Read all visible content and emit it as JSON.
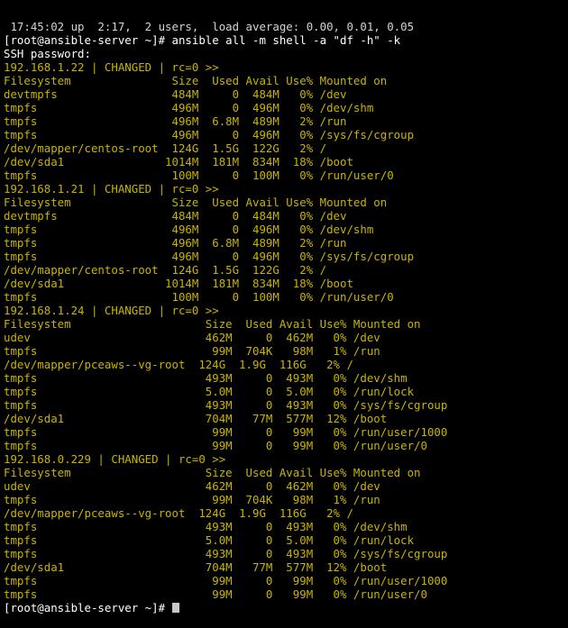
{
  "terminal": {
    "colors": {
      "background": "#000000",
      "default_text": "#d4d4d4",
      "changed_header": "#c8b400",
      "filesystem_rows": "#2ecc40"
    },
    "lines": [
      {
        "text": " 17:45:02 up  2:17,  2 users,  load average: 0.00, 0.01, 0.05",
        "color": "gray"
      },
      {
        "text": "[root@ansible-server ~]# ansible all -m shell -a \"df -h\" -k",
        "color": "white"
      },
      {
        "text": "SSH password:",
        "color": "white"
      },
      {
        "text": "192.168.1.22 | CHANGED | rc=0 >>",
        "color": "yellow"
      },
      {
        "text": "Filesystem               Size  Used Avail Use% Mounted on",
        "color": "yellow"
      },
      {
        "text": "devtmpfs                 484M     0  484M   0% /dev",
        "color": "yellow"
      },
      {
        "text": "tmpfs                    496M     0  496M   0% /dev/shm",
        "color": "yellow"
      },
      {
        "text": "tmpfs                    496M  6.8M  489M   2% /run",
        "color": "yellow"
      },
      {
        "text": "tmpfs                    496M     0  496M   0% /sys/fs/cgroup",
        "color": "yellow"
      },
      {
        "text": "/dev/mapper/centos-root  124G  1.5G  122G   2% /",
        "color": "yellow"
      },
      {
        "text": "/dev/sda1               1014M  181M  834M  18% /boot",
        "color": "yellow"
      },
      {
        "text": "tmpfs                    100M     0  100M   0% /run/user/0",
        "color": "yellow"
      },
      {
        "text": "192.168.1.21 | CHANGED | rc=0 >>",
        "color": "yellow"
      },
      {
        "text": "Filesystem               Size  Used Avail Use% Mounted on",
        "color": "yellow"
      },
      {
        "text": "devtmpfs                 484M     0  484M   0% /dev",
        "color": "yellow"
      },
      {
        "text": "tmpfs                    496M     0  496M   0% /dev/shm",
        "color": "yellow"
      },
      {
        "text": "tmpfs                    496M  6.8M  489M   2% /run",
        "color": "yellow"
      },
      {
        "text": "tmpfs                    496M     0  496M   0% /sys/fs/cgroup",
        "color": "yellow"
      },
      {
        "text": "/dev/mapper/centos-root  124G  1.5G  122G   2% /",
        "color": "yellow"
      },
      {
        "text": "/dev/sda1               1014M  181M  834M  18% /boot",
        "color": "yellow"
      },
      {
        "text": "tmpfs                    100M     0  100M   0% /run/user/0",
        "color": "yellow"
      },
      {
        "text": "192.168.1.24 | CHANGED | rc=0 >>",
        "color": "yellow"
      },
      {
        "text": "Filesystem                    Size  Used Avail Use% Mounted on",
        "color": "yellow"
      },
      {
        "text": "udev                          462M     0  462M   0% /dev",
        "color": "yellow"
      },
      {
        "text": "tmpfs                          99M  704K   98M   1% /run",
        "color": "yellow"
      },
      {
        "text": "/dev/mapper/pceaws--vg-root  124G  1.9G  116G   2% /",
        "color": "yellow"
      },
      {
        "text": "tmpfs                         493M     0  493M   0% /dev/shm",
        "color": "yellow"
      },
      {
        "text": "tmpfs                         5.0M     0  5.0M   0% /run/lock",
        "color": "yellow"
      },
      {
        "text": "tmpfs                         493M     0  493M   0% /sys/fs/cgroup",
        "color": "yellow"
      },
      {
        "text": "/dev/sda1                     704M   77M  577M  12% /boot",
        "color": "yellow"
      },
      {
        "text": "tmpfs                          99M     0   99M   0% /run/user/1000",
        "color": "yellow"
      },
      {
        "text": "tmpfs                          99M     0   99M   0% /run/user/0",
        "color": "yellow"
      },
      {
        "text": "192.168.0.229 | CHANGED | rc=0 >>",
        "color": "yellow"
      },
      {
        "text": "Filesystem                    Size  Used Avail Use% Mounted on",
        "color": "yellow"
      },
      {
        "text": "udev                          462M     0  462M   0% /dev",
        "color": "yellow"
      },
      {
        "text": "tmpfs                          99M  704K   98M   1% /run",
        "color": "yellow"
      },
      {
        "text": "/dev/mapper/pceaws--vg-root  124G  1.9G  116G   2% /",
        "color": "yellow"
      },
      {
        "text": "tmpfs                         493M     0  493M   0% /dev/shm",
        "color": "yellow"
      },
      {
        "text": "tmpfs                         5.0M     0  5.0M   0% /run/lock",
        "color": "yellow"
      },
      {
        "text": "tmpfs                         493M     0  493M   0% /sys/fs/cgroup",
        "color": "yellow"
      },
      {
        "text": "/dev/sda1                     704M   77M  577M  12% /boot",
        "color": "yellow"
      },
      {
        "text": "tmpfs                          99M     0   99M   0% /run/user/1000",
        "color": "yellow"
      },
      {
        "text": "tmpfs                          99M     0   99M   0% /run/user/0",
        "color": "yellow"
      },
      {
        "text": "[root@ansible-server ~]# ",
        "color": "white",
        "cursor": true
      }
    ]
  }
}
